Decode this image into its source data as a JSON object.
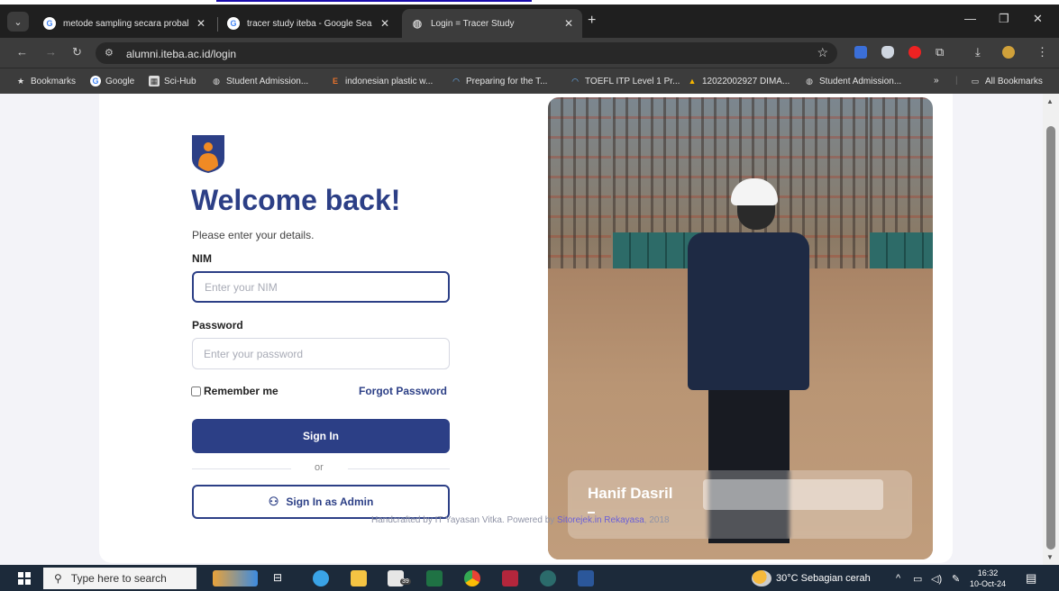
{
  "browser": {
    "tabs": [
      {
        "title": "metode sampling secara probal",
        "active": false
      },
      {
        "title": "tracer study iteba - Google Sea",
        "active": false
      },
      {
        "title": "Login = Tracer Study",
        "active": true
      }
    ],
    "url": "alumni.iteba.ac.id/login",
    "bookmarks": [
      {
        "label": "Bookmarks"
      },
      {
        "label": "Google"
      },
      {
        "label": "Sci-Hub"
      },
      {
        "label": "Student Admission..."
      },
      {
        "label": "indonesian plastic w..."
      },
      {
        "label": "Preparing for the T..."
      },
      {
        "label": "TOEFL ITP Level 1 Pr..."
      },
      {
        "label": "12022002927 DIMA..."
      },
      {
        "label": "Student Admission..."
      }
    ],
    "more_bookmarks": "»",
    "all_bookmarks": "All Bookmarks"
  },
  "login": {
    "title": "Welcome back!",
    "subtitle": "Please enter your details.",
    "nim_label": "NIM",
    "nim_placeholder": "Enter your NIM",
    "password_label": "Password",
    "password_placeholder": "Enter your password",
    "remember_label": "Remember me",
    "forgot_label": "Forgot Password",
    "signin_label": "Sign In",
    "or_label": "or",
    "admin_label": "Sign In as Admin"
  },
  "testimonial": {
    "name": "Hanif Dasril"
  },
  "footer": {
    "prefix": "Handcrafted by IT Yayasan Vitka. Powered by ",
    "link": "Sitorejek.in Rekayasa",
    "suffix": ", 2018"
  },
  "taskbar": {
    "search_placeholder": "Type here to search",
    "weather": "30°C  Sebagian cerah",
    "time": "16:32",
    "date": "10-Oct-24",
    "mail_badge": "39"
  },
  "colors": {
    "brand": "#2c3f86",
    "logo_orange": "#f08a24"
  }
}
